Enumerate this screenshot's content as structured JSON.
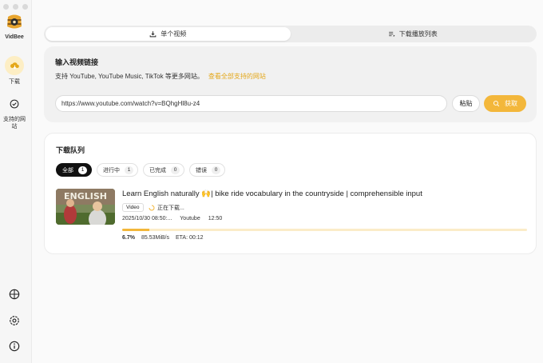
{
  "app": {
    "name": "VidBee"
  },
  "sidebar": {
    "items": [
      {
        "label": "下载",
        "icon": "download-cloud-icon"
      },
      {
        "label": "支持的网站",
        "icon": "check-circle-icon"
      }
    ],
    "bottom_icons": [
      "globe-icon",
      "settings-icon",
      "info-icon"
    ]
  },
  "tabs": [
    {
      "label": "单个视频",
      "icon": "download-icon"
    },
    {
      "label": "下载播放列表",
      "icon": "playlist-icon"
    }
  ],
  "input_section": {
    "title": "输入视频链接",
    "support_text": "支持 YouTube, YouTube Music, TikTok 等更多网站。",
    "support_link": "查看全部支持的网站",
    "url_value": "https://www.youtube.com/watch?v=BQhgHl8u-z4",
    "paste_label": "粘贴",
    "fetch_label": "获取"
  },
  "queue": {
    "title": "下载队列",
    "filters": [
      {
        "label": "全部",
        "count": "1"
      },
      {
        "label": "进行中",
        "count": "1"
      },
      {
        "label": "已完成",
        "count": "0"
      },
      {
        "label": "错误",
        "count": "0"
      }
    ],
    "items": [
      {
        "title": "Learn English naturally 🙌| bike ride vocabulary in the countryside | comprehensible input",
        "thumb_text": "ENGLISH",
        "tag": "Video",
        "status": "正在下载...",
        "date": "2025/10/30 08:50:...",
        "source": "Youtube",
        "duration": "12:50",
        "progress_percent": 6.7,
        "progress_text": "6.7%",
        "speed": "85.53MiB/s",
        "eta": "ETA: 00:12"
      }
    ]
  },
  "colors": {
    "accent": "#f3b73b",
    "link": "#e4a719"
  }
}
